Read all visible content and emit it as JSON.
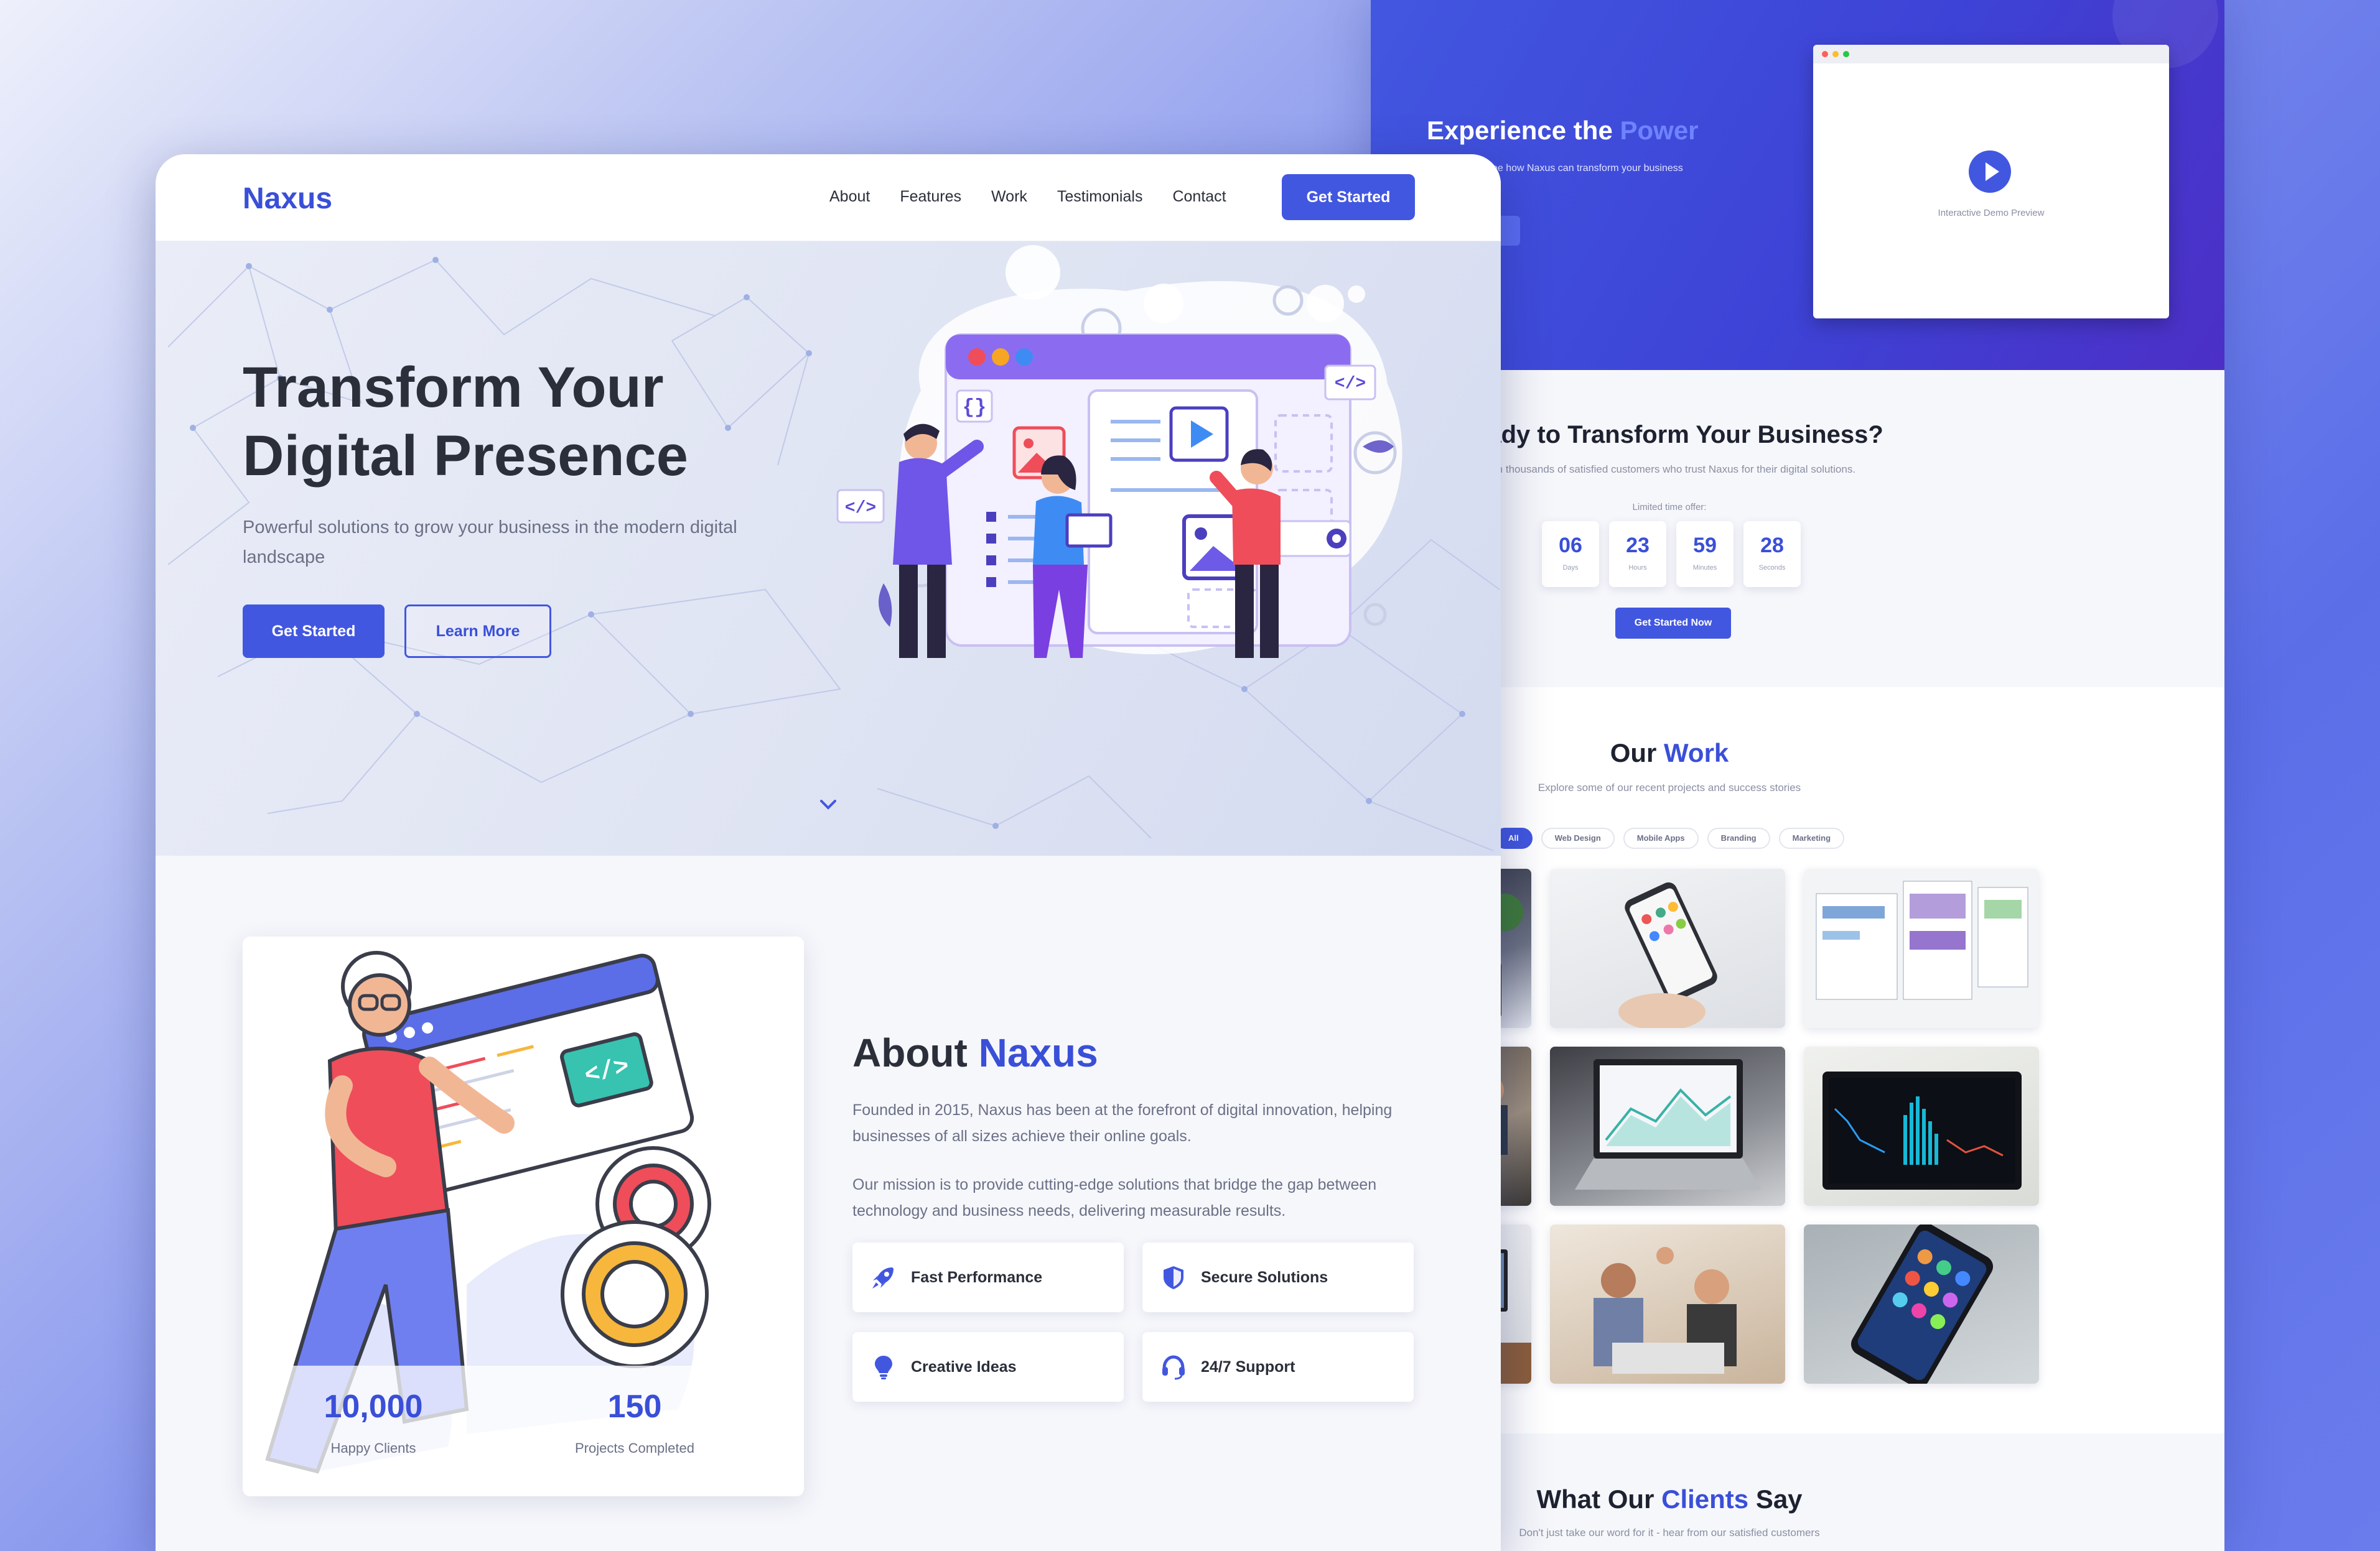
{
  "brand": {
    "name": "Naxus",
    "accent": "#4257e0"
  },
  "nav": {
    "links": [
      "About",
      "Features",
      "Work",
      "Testimonials",
      "Contact"
    ],
    "cta": "Get Started"
  },
  "hero": {
    "title_line1": "Transform Your",
    "title_line2": "Digital Presence",
    "subtitle": "Powerful solutions to grow your business in the modern digital landscape",
    "primary_btn": "Get Started",
    "secondary_btn": "Learn More"
  },
  "about": {
    "title_a": "About",
    "title_b": "Naxus",
    "p1": "Founded in 2015, Naxus has been at the forefront of digital innovation, helping businesses of all sizes achieve their online goals.",
    "p2": "Our mission is to provide cutting-edge solutions that bridge the gap between technology and business needs, delivering measurable results.",
    "features": [
      {
        "label": "Fast Performance",
        "icon": "rocket-icon"
      },
      {
        "label": "Secure Solutions",
        "icon": "shield-icon"
      },
      {
        "label": "Creative Ideas",
        "icon": "lightbulb-icon"
      },
      {
        "label": "24/7 Support",
        "icon": "headset-icon"
      }
    ],
    "stats": [
      {
        "value": "10,000",
        "label": "Happy Clients"
      },
      {
        "value": "150",
        "label": "Projects Completed"
      }
    ]
  },
  "demo": {
    "title_a": "Experience the",
    "title_b": "Power",
    "subtitle": "ve demo and see how Naxus can transform your business",
    "caption": "Interactive Demo Preview"
  },
  "cta": {
    "title": "Ready to Transform Your Business?",
    "subtitle": "Join thousands of satisfied customers who trust Naxus for their digital solutions.",
    "offer": "Limited time offer:",
    "countdown": [
      {
        "value": "06",
        "label": "Days"
      },
      {
        "value": "23",
        "label": "Hours"
      },
      {
        "value": "59",
        "label": "Minutes"
      },
      {
        "value": "28",
        "label": "Seconds"
      }
    ],
    "button": "Get Started Now"
  },
  "work": {
    "title_a": "Our",
    "title_b": "Work",
    "subtitle": "Explore some of our recent projects and success stories",
    "filters": [
      "All",
      "Web Design",
      "Mobile Apps",
      "Branding",
      "Marketing"
    ],
    "active_filter": "All"
  },
  "testimonials": {
    "title_a": "What Our",
    "title_b": "Clients",
    "title_c": "Say",
    "subtitle": "Don't just take our word for it - hear from our satisfied customers"
  }
}
